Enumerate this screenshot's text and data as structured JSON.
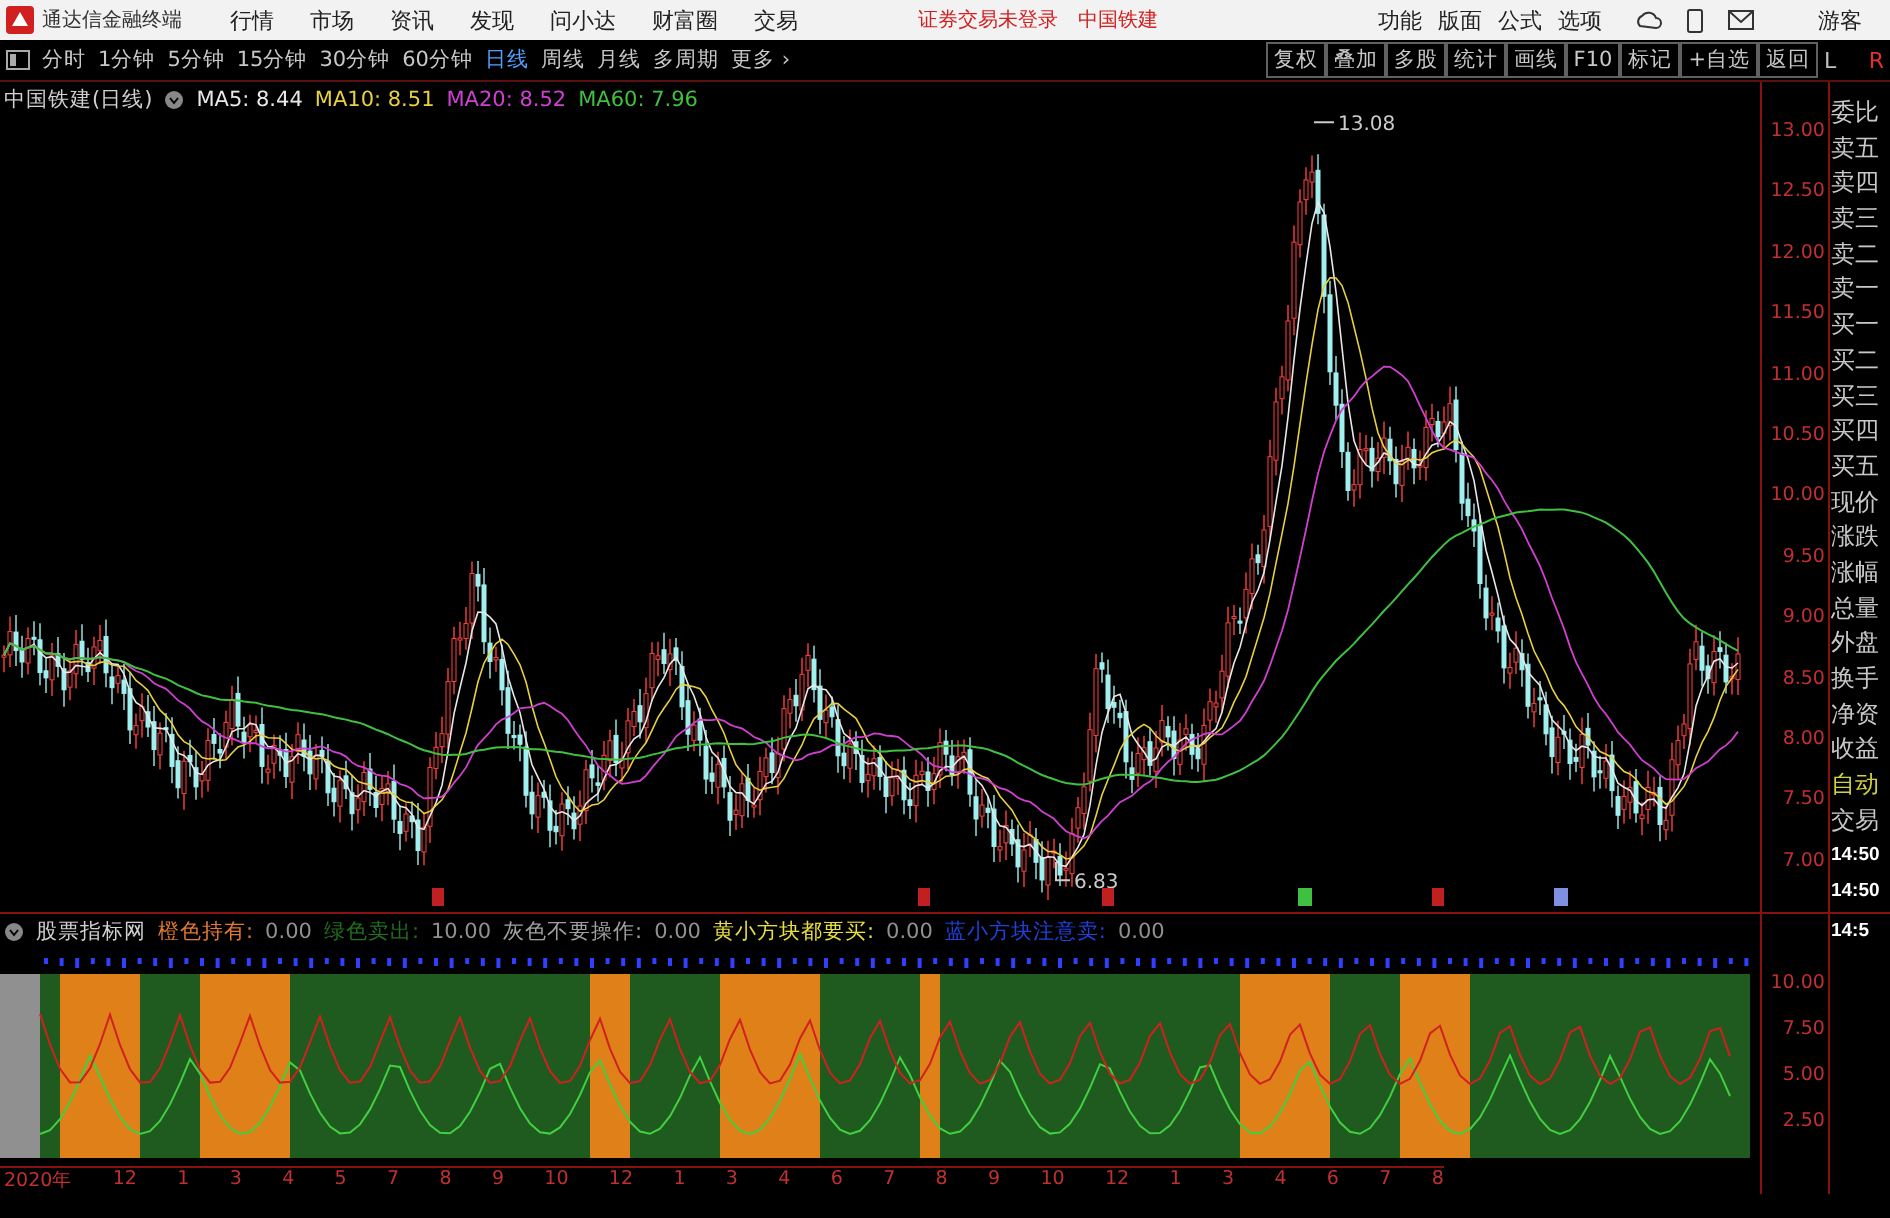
{
  "title_bar": {
    "app_name": "通达信金融终端",
    "menu": [
      "行情",
      "市场",
      "资讯",
      "发现",
      "问小达",
      "财富圈",
      "交易"
    ],
    "login_status": "证券交易未登录",
    "stock": "中国铁建",
    "tools": [
      "功能",
      "版面",
      "公式",
      "选项"
    ],
    "user": "游客"
  },
  "period_bar": {
    "periods": [
      {
        "label": "分时",
        "selected": false
      },
      {
        "label": "1分钟",
        "selected": false
      },
      {
        "label": "5分钟",
        "selected": false
      },
      {
        "label": "15分钟",
        "selected": false
      },
      {
        "label": "30分钟",
        "selected": false
      },
      {
        "label": "60分钟",
        "selected": false
      },
      {
        "label": "日线",
        "selected": true
      },
      {
        "label": "周线",
        "selected": false
      },
      {
        "label": "月线",
        "selected": false
      },
      {
        "label": "多周期",
        "selected": false
      }
    ],
    "more": "更多 ›",
    "actions": [
      "复权",
      "叠加",
      "多股",
      "统计",
      "画线",
      "F10",
      "标记",
      "+自选",
      "返回"
    ]
  },
  "main_chart": {
    "title": "中国铁建(日线)",
    "ma": [
      {
        "label": "MA5: 8.44",
        "color": "#e8e8e8"
      },
      {
        "label": "MA10: 8.51",
        "color": "#e8d040"
      },
      {
        "label": "MA20: 8.52",
        "color": "#d040d0"
      },
      {
        "label": "MA60: 7.96",
        "color": "#40c040"
      }
    ],
    "high_label": "13.08",
    "low_label": "6.83",
    "price_axis": [
      "13.00",
      "12.50",
      "12.00",
      "11.50",
      "11.00",
      "10.50",
      "10.00",
      "9.50",
      "9.00",
      "8.50",
      "8.00",
      "7.50",
      "7.00"
    ]
  },
  "indicator": {
    "name": "股票指标网",
    "legend": [
      {
        "label": "橙色持有:",
        "value": "0.00",
        "color": "#e07830"
      },
      {
        "label": "绿色卖出:",
        "value": "10.00",
        "color": "#207020"
      },
      {
        "label": "灰色不要操作:",
        "value": "0.00",
        "color": "#a0a0a0"
      },
      {
        "label": "黄小方块都要买:",
        "value": "0.00",
        "color": "#e8e040"
      },
      {
        "label": "蓝小方块注意卖:",
        "value": "0.00",
        "color": "#2040e0"
      }
    ],
    "axis": [
      "10.00",
      "7.50",
      "5.00",
      "2.50"
    ]
  },
  "quote_panel": {
    "top": [
      "L",
      "R"
    ],
    "rows": [
      {
        "label": "委比",
        "kind": "label"
      },
      {
        "label": "卖五",
        "kind": "label"
      },
      {
        "label": "卖四",
        "kind": "label"
      },
      {
        "label": "卖三",
        "kind": "label"
      },
      {
        "label": "卖二",
        "kind": "label"
      },
      {
        "label": "卖一",
        "kind": "label"
      },
      {
        "label": "买一",
        "kind": "label"
      },
      {
        "label": "买二",
        "kind": "label"
      },
      {
        "label": "买三",
        "kind": "label"
      },
      {
        "label": "买四",
        "kind": "label"
      },
      {
        "label": "买五",
        "kind": "label"
      },
      {
        "label": "现价",
        "kind": "label"
      },
      {
        "label": "涨跌",
        "kind": "label"
      },
      {
        "label": "涨幅",
        "kind": "label"
      },
      {
        "label": "总量",
        "kind": "label"
      },
      {
        "label": "外盘",
        "kind": "label"
      },
      {
        "label": "换手",
        "kind": "label"
      },
      {
        "label": "净资",
        "kind": "label"
      },
      {
        "label": "收益",
        "kind": "label"
      },
      {
        "label": "自动",
        "kind": "auto"
      },
      {
        "label": "交易",
        "kind": "label"
      },
      {
        "label": "14:50",
        "kind": "time"
      },
      {
        "label": "14:50",
        "kind": "time"
      },
      {
        "label": "14:5",
        "kind": "time"
      }
    ]
  },
  "date_axis": [
    "2020年",
    "12",
    "1",
    "3",
    "4",
    "5",
    "7",
    "8",
    "9",
    "10",
    "12",
    "1",
    "3",
    "4",
    "6",
    "7",
    "8",
    "9",
    "10",
    "12",
    "1",
    "3",
    "4",
    "6",
    "7",
    "8"
  ]
}
